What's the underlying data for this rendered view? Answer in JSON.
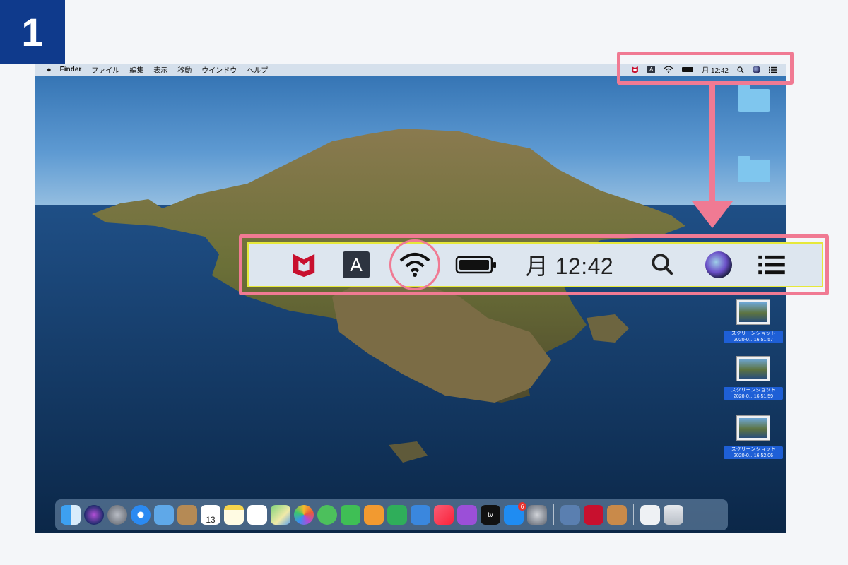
{
  "step": {
    "number": "1"
  },
  "menubar": {
    "apple_icon": "apple-icon",
    "items": [
      "Finder",
      "ファイル",
      "編集",
      "表示",
      "移動",
      "ウインドウ",
      "ヘルプ"
    ],
    "status": {
      "input_source": "A",
      "clock": "月 12:42",
      "icons": [
        "mcafee-icon",
        "input-source-icon",
        "wifi-icon",
        "battery-icon",
        "search-icon",
        "siri-icon",
        "notification-center-icon"
      ]
    }
  },
  "zoomed_status": {
    "input_source": "A",
    "clock": "月 12:42",
    "highlighted": "wifi-icon"
  },
  "desktop": {
    "items": [
      {
        "type": "folder",
        "label": ""
      },
      {
        "type": "folder",
        "label": ""
      },
      {
        "type": "screenshot",
        "label": "スクリーンショット\n2020-0…16.51.57"
      },
      {
        "type": "screenshot",
        "label": "スクリーンショット\n2020-0…16.51.59"
      },
      {
        "type": "screenshot",
        "label": "スクリーンショット\n2020-0…16.52.06"
      }
    ]
  },
  "dock": {
    "apps": [
      "finder-icon",
      "siri-icon",
      "launchpad-icon",
      "safari-icon",
      "mail-icon",
      "contacts-icon",
      "calendar-icon",
      "notes-icon",
      "reminders-icon",
      "maps-icon",
      "photos-icon",
      "messages-icon",
      "facetime-icon",
      "pages-icon",
      "numbers-icon",
      "keynote-icon",
      "music-icon",
      "podcasts-icon",
      "tv-icon",
      "app-store-icon",
      "system-preferences-icon"
    ],
    "others": [
      "photo-booth-icon",
      "mcafee-icon",
      "archive-utility-icon",
      "downloads-icon",
      "trash-icon"
    ],
    "calendar_day": "13",
    "tv_label": "tv",
    "badges": {
      "app-store-icon": "6"
    }
  },
  "colors": {
    "badge": "#0f3a8c",
    "highlight": "#f07a93",
    "zoom_border": "#e6e83a",
    "mcafee_red": "#c8102e"
  }
}
